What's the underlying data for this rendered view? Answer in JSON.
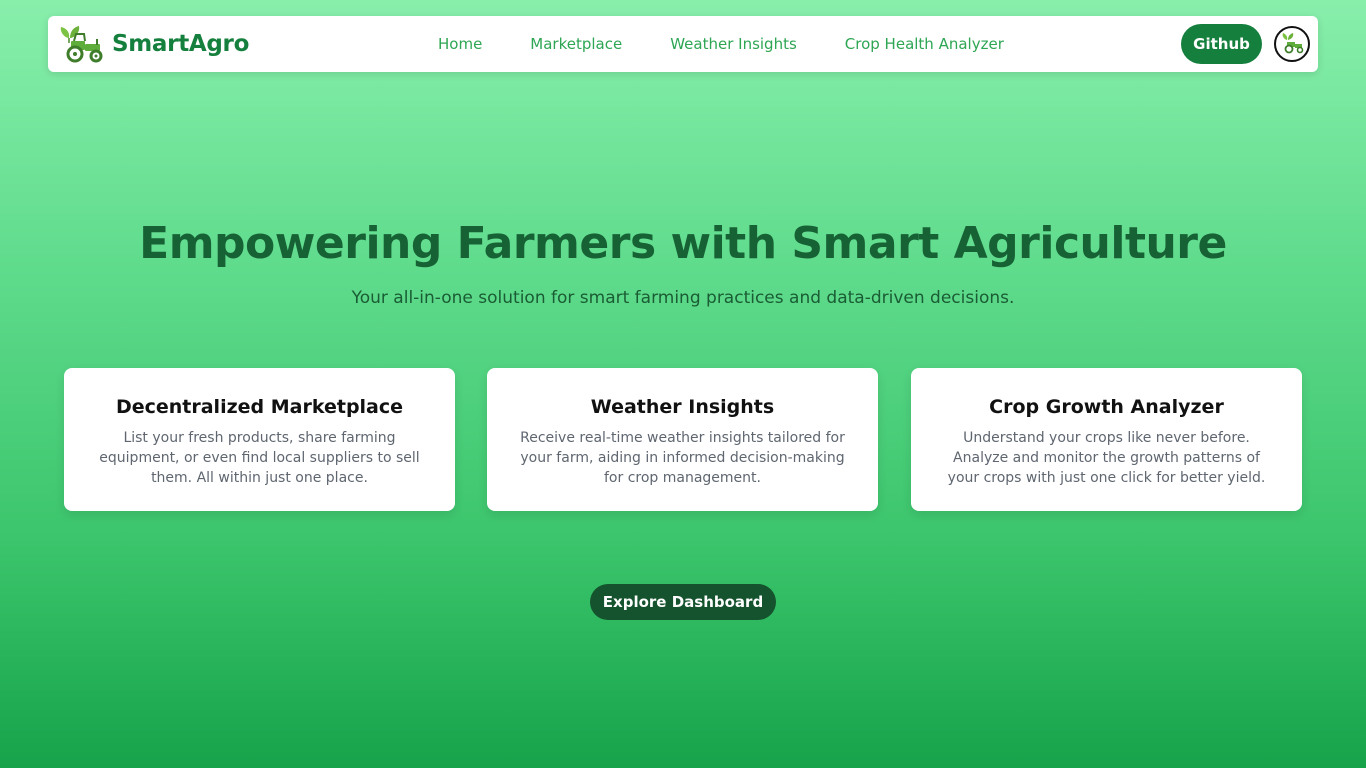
{
  "navbar": {
    "brand_name": "SmartAgro",
    "brand_logo_icon": "tractor-with-leaves-icon",
    "links": [
      {
        "label": "Home"
      },
      {
        "label": "Marketplace"
      },
      {
        "label": "Weather Insights"
      },
      {
        "label": "Crop Health Analyzer"
      }
    ],
    "github_label": "Github",
    "avatar_icon": "tractor-with-leaves-icon"
  },
  "hero": {
    "title": "Empowering Farmers with Smart Agriculture",
    "subtitle": "Your all-in-one solution for smart farming practices and data-driven decisions."
  },
  "features": [
    {
      "title": "Decentralized Marketplace",
      "description": "List your fresh products, share farming equipment, or even find local suppliers to sell them. All within just one place."
    },
    {
      "title": "Weather Insights",
      "description": "Receive real-time weather insights tailored for your farm, aiding in informed decision-making for crop management."
    },
    {
      "title": "Crop Growth Analyzer",
      "description": "Understand your crops like never before. Analyze and monitor the growth patterns of your crops with just one click for better yield."
    }
  ],
  "cta": {
    "label": "Explore Dashboard"
  },
  "colors": {
    "brand_green": "#15803d",
    "nav_link_green": "#2ea653",
    "hero_title": "#176235",
    "cta_background": "#14532d",
    "background_top": "#88efab",
    "background_bottom": "#16a34a"
  }
}
